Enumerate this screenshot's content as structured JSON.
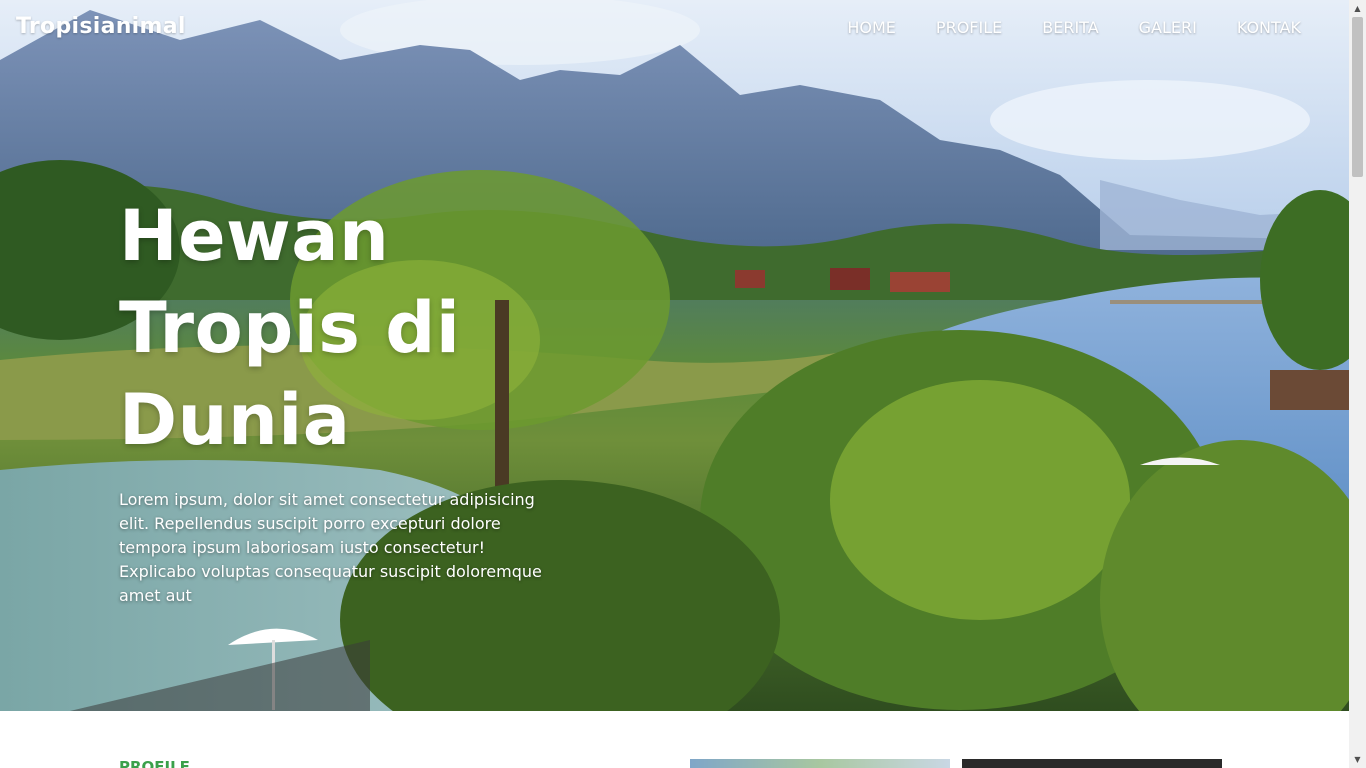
{
  "navbar": {
    "brand": "Tropisianimal",
    "links": [
      "HOME",
      "PROFILE",
      "BERITA",
      "GALERI",
      "KONTAK"
    ]
  },
  "hero": {
    "title_line1": "Hewan",
    "title_line2": "Tropis di Dunia",
    "description": "Lorem ipsum, dolor sit amet consectetur adipisicing elit. Repellendus suscipit porro excepturi dolore tempora ipsum laboriosam iusto consectetur! Explicabo voluptas consequatur suscipit doloremque amet aut"
  },
  "section": {
    "label": "PROFILE"
  },
  "colors": {
    "accent_green": "#3aa04a",
    "nav_text": "#ffffff"
  },
  "icons": {
    "scroll_up": "triangle-up-icon",
    "scroll_down": "triangle-down-icon"
  }
}
